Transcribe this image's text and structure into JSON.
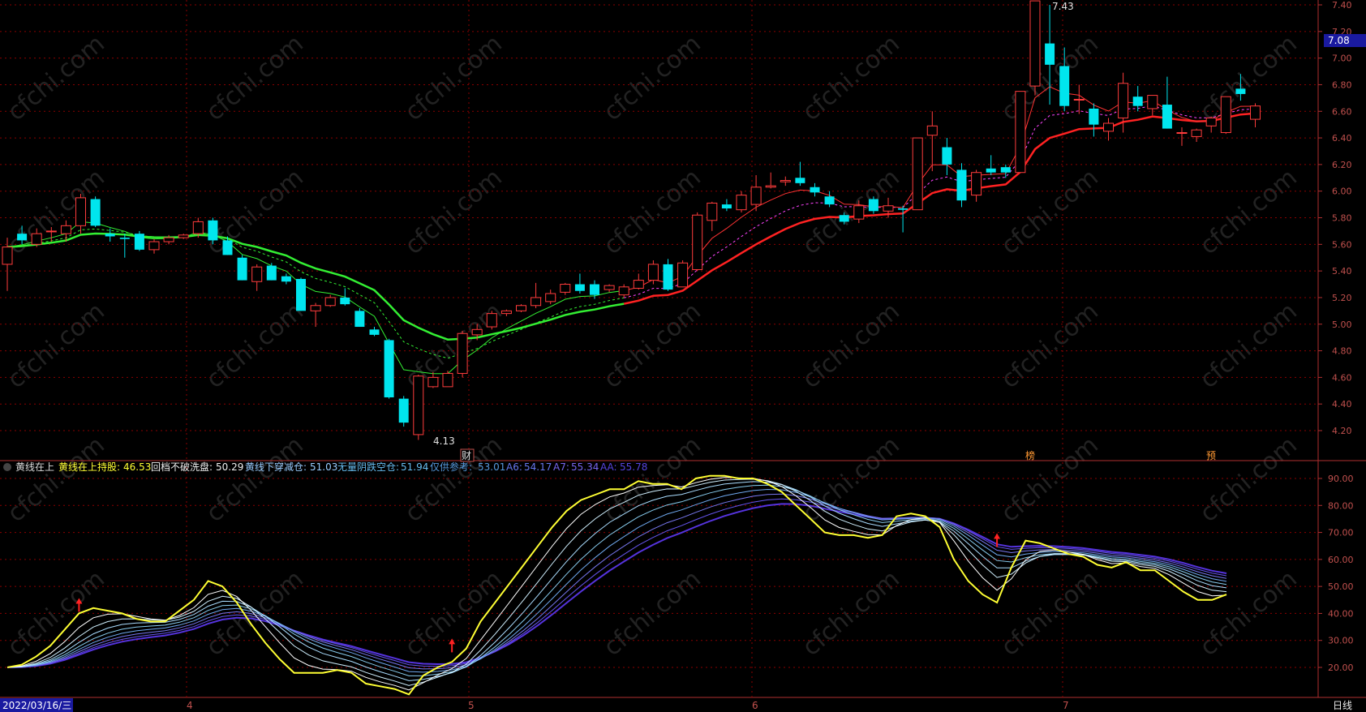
{
  "colors": {
    "background": "#000000",
    "grid": "#8b0000",
    "up": "#ff3c3c",
    "down": "#00e5ee",
    "axis_text": "#c0504d",
    "yellow": "#ffff33",
    "green": "#33ee33",
    "purple": "#9966ff",
    "magenta": "#ff44ff",
    "price_tag_bg": "#1a1aa0"
  },
  "main_panel": {
    "y_ticks": [
      "7.40",
      "7.20",
      "7.00",
      "6.80",
      "6.60",
      "6.40",
      "6.20",
      "6.00",
      "5.80",
      "5.60",
      "5.40",
      "5.20",
      "5.00",
      "4.80",
      "4.60",
      "4.40",
      "4.20"
    ],
    "current_price": "7.08",
    "high_label": "7.43",
    "low_label": "4.13",
    "markers": [
      "财",
      "榜",
      "预"
    ]
  },
  "indicator_panel": {
    "legend": [
      {
        "label": "黄线在上",
        "value": ""
      },
      {
        "label": "黄线在上持股:",
        "value": "46.53"
      },
      {
        "label": "回档不破洗盘:",
        "value": "50.29"
      },
      {
        "label": "黄线下穿减仓:",
        "value": "51.03"
      },
      {
        "label": "无量阴跌空仓:",
        "value": "51.94"
      },
      {
        "label": "仅供参考:",
        "value": "53.01"
      },
      {
        "label": "A6:",
        "value": "54.17"
      },
      {
        "label": "A7:",
        "value": "55.34"
      },
      {
        "label": "AA:",
        "value": "55.78"
      }
    ],
    "y_ticks": [
      "90.00",
      "80.00",
      "70.00",
      "60.00",
      "50.00",
      "40.00",
      "30.00",
      "20.00"
    ]
  },
  "x_axis": {
    "date_label": "2022/03/16/三",
    "month_labels": [
      "4",
      "5",
      "6",
      "7"
    ],
    "period_label": "日线"
  },
  "watermark": "cfchi.com",
  "chart_data": [
    {
      "type": "candlestick",
      "title": "",
      "ylim": [
        4.1,
        7.45
      ],
      "candles": [
        {
          "o": 5.45,
          "h": 5.65,
          "l": 5.25,
          "c": 5.58
        },
        {
          "o": 5.68,
          "h": 5.74,
          "l": 5.6,
          "c": 5.63
        },
        {
          "o": 5.6,
          "h": 5.72,
          "l": 5.58,
          "c": 5.68
        },
        {
          "o": 5.7,
          "h": 5.73,
          "l": 5.62,
          "c": 5.7
        },
        {
          "o": 5.68,
          "h": 5.78,
          "l": 5.62,
          "c": 5.74
        },
        {
          "o": 5.74,
          "h": 5.98,
          "l": 5.68,
          "c": 5.95
        },
        {
          "o": 5.94,
          "h": 5.96,
          "l": 5.73,
          "c": 5.74
        },
        {
          "o": 5.68,
          "h": 5.72,
          "l": 5.62,
          "c": 5.66
        },
        {
          "o": 5.65,
          "h": 5.68,
          "l": 5.5,
          "c": 5.64
        },
        {
          "o": 5.68,
          "h": 5.7,
          "l": 5.55,
          "c": 5.56
        },
        {
          "o": 5.56,
          "h": 5.64,
          "l": 5.53,
          "c": 5.62
        },
        {
          "o": 5.62,
          "h": 5.67,
          "l": 5.6,
          "c": 5.65
        },
        {
          "o": 5.65,
          "h": 5.68,
          "l": 5.64,
          "c": 5.67
        },
        {
          "o": 5.68,
          "h": 5.8,
          "l": 5.65,
          "c": 5.77
        },
        {
          "o": 5.78,
          "h": 5.8,
          "l": 5.6,
          "c": 5.63
        },
        {
          "o": 5.63,
          "h": 5.66,
          "l": 5.52,
          "c": 5.52
        },
        {
          "o": 5.5,
          "h": 5.52,
          "l": 5.33,
          "c": 5.33
        },
        {
          "o": 5.32,
          "h": 5.45,
          "l": 5.25,
          "c": 5.43
        },
        {
          "o": 5.44,
          "h": 5.46,
          "l": 5.33,
          "c": 5.33
        },
        {
          "o": 5.36,
          "h": 5.38,
          "l": 5.3,
          "c": 5.32
        },
        {
          "o": 5.34,
          "h": 5.35,
          "l": 5.1,
          "c": 5.1
        },
        {
          "o": 5.1,
          "h": 5.16,
          "l": 4.98,
          "c": 5.14
        },
        {
          "o": 5.14,
          "h": 5.22,
          "l": 5.13,
          "c": 5.2
        },
        {
          "o": 5.2,
          "h": 5.27,
          "l": 5.14,
          "c": 5.15
        },
        {
          "o": 5.1,
          "h": 5.12,
          "l": 4.98,
          "c": 4.98
        },
        {
          "o": 4.96,
          "h": 4.98,
          "l": 4.91,
          "c": 4.92
        },
        {
          "o": 4.88,
          "h": 4.89,
          "l": 4.44,
          "c": 4.45
        },
        {
          "o": 4.44,
          "h": 4.46,
          "l": 4.23,
          "c": 4.26
        },
        {
          "o": 4.17,
          "h": 4.62,
          "l": 4.13,
          "c": 4.61
        },
        {
          "o": 4.53,
          "h": 4.64,
          "l": 4.52,
          "c": 4.6
        },
        {
          "o": 4.53,
          "h": 4.65,
          "l": 4.53,
          "c": 4.63
        },
        {
          "o": 4.63,
          "h": 4.95,
          "l": 4.6,
          "c": 4.93
        },
        {
          "o": 4.92,
          "h": 5.0,
          "l": 4.88,
          "c": 4.96
        },
        {
          "o": 4.98,
          "h": 5.1,
          "l": 4.96,
          "c": 5.08
        },
        {
          "o": 5.08,
          "h": 5.11,
          "l": 5.06,
          "c": 5.1
        },
        {
          "o": 5.1,
          "h": 5.15,
          "l": 5.09,
          "c": 5.14
        },
        {
          "o": 5.14,
          "h": 5.31,
          "l": 5.12,
          "c": 5.2
        },
        {
          "o": 5.17,
          "h": 5.26,
          "l": 5.15,
          "c": 5.23
        },
        {
          "o": 5.24,
          "h": 5.31,
          "l": 5.22,
          "c": 5.3
        },
        {
          "o": 5.3,
          "h": 5.38,
          "l": 5.23,
          "c": 5.25
        },
        {
          "o": 5.3,
          "h": 5.33,
          "l": 5.19,
          "c": 5.22
        },
        {
          "o": 5.26,
          "h": 5.3,
          "l": 5.24,
          "c": 5.29
        },
        {
          "o": 5.22,
          "h": 5.3,
          "l": 5.2,
          "c": 5.28
        },
        {
          "o": 5.27,
          "h": 5.38,
          "l": 5.26,
          "c": 5.33
        },
        {
          "o": 5.33,
          "h": 5.48,
          "l": 5.3,
          "c": 5.45
        },
        {
          "o": 5.45,
          "h": 5.49,
          "l": 5.25,
          "c": 5.26
        },
        {
          "o": 5.28,
          "h": 5.48,
          "l": 5.28,
          "c": 5.46
        },
        {
          "o": 5.41,
          "h": 5.84,
          "l": 5.4,
          "c": 5.82
        },
        {
          "o": 5.78,
          "h": 5.92,
          "l": 5.7,
          "c": 5.91
        },
        {
          "o": 5.9,
          "h": 5.94,
          "l": 5.85,
          "c": 5.87
        },
        {
          "o": 5.86,
          "h": 6.0,
          "l": 5.84,
          "c": 5.97
        },
        {
          "o": 5.9,
          "h": 6.12,
          "l": 5.85,
          "c": 6.03
        },
        {
          "o": 6.03,
          "h": 6.14,
          "l": 6.02,
          "c": 6.04
        },
        {
          "o": 6.07,
          "h": 6.11,
          "l": 6.04,
          "c": 6.08
        },
        {
          "o": 6.1,
          "h": 6.22,
          "l": 6.04,
          "c": 6.06
        },
        {
          "o": 6.03,
          "h": 6.06,
          "l": 5.96,
          "c": 5.99
        },
        {
          "o": 5.96,
          "h": 6.0,
          "l": 5.88,
          "c": 5.9
        },
        {
          "o": 5.82,
          "h": 5.84,
          "l": 5.75,
          "c": 5.77
        },
        {
          "o": 5.79,
          "h": 5.93,
          "l": 5.76,
          "c": 5.89
        },
        {
          "o": 5.94,
          "h": 5.96,
          "l": 5.83,
          "c": 5.85
        },
        {
          "o": 5.85,
          "h": 5.95,
          "l": 5.8,
          "c": 5.89
        },
        {
          "o": 5.87,
          "h": 5.89,
          "l": 5.69,
          "c": 5.86
        },
        {
          "o": 5.86,
          "h": 6.4,
          "l": 5.86,
          "c": 6.4
        },
        {
          "o": 6.42,
          "h": 6.6,
          "l": 6.15,
          "c": 6.49
        },
        {
          "o": 6.33,
          "h": 6.4,
          "l": 6.12,
          "c": 6.2
        },
        {
          "o": 6.16,
          "h": 6.21,
          "l": 5.88,
          "c": 5.93
        },
        {
          "o": 5.97,
          "h": 6.16,
          "l": 5.92,
          "c": 6.14
        },
        {
          "o": 6.17,
          "h": 6.27,
          "l": 6.12,
          "c": 6.14
        },
        {
          "o": 6.18,
          "h": 6.2,
          "l": 6.1,
          "c": 6.14
        },
        {
          "o": 6.14,
          "h": 6.75,
          "l": 6.14,
          "c": 6.75
        },
        {
          "o": 6.79,
          "h": 7.43,
          "l": 6.72,
          "c": 7.43
        },
        {
          "o": 7.11,
          "h": 7.4,
          "l": 6.65,
          "c": 6.95
        },
        {
          "o": 6.94,
          "h": 7.08,
          "l": 6.6,
          "c": 6.64
        },
        {
          "o": 6.69,
          "h": 6.8,
          "l": 6.58,
          "c": 6.69
        },
        {
          "o": 6.62,
          "h": 6.66,
          "l": 6.41,
          "c": 6.5
        },
        {
          "o": 6.45,
          "h": 6.55,
          "l": 6.38,
          "c": 6.51
        },
        {
          "o": 6.55,
          "h": 6.89,
          "l": 6.44,
          "c": 6.81
        },
        {
          "o": 6.71,
          "h": 6.79,
          "l": 6.6,
          "c": 6.64
        },
        {
          "o": 6.62,
          "h": 6.72,
          "l": 6.57,
          "c": 6.72
        },
        {
          "o": 6.65,
          "h": 6.86,
          "l": 6.47,
          "c": 6.47
        },
        {
          "o": 6.44,
          "h": 6.48,
          "l": 6.34,
          "c": 6.44
        },
        {
          "o": 6.41,
          "h": 6.47,
          "l": 6.37,
          "c": 6.46
        },
        {
          "o": 6.49,
          "h": 6.56,
          "l": 6.44,
          "c": 6.55
        },
        {
          "o": 6.44,
          "h": 6.71,
          "l": 6.43,
          "c": 6.71
        },
        {
          "o": 6.77,
          "h": 6.88,
          "l": 6.68,
          "c": 6.73
        },
        {
          "o": 6.54,
          "h": 6.66,
          "l": 6.48,
          "c": 6.64
        }
      ]
    },
    {
      "type": "line",
      "title": "",
      "ylim": [
        15,
        95
      ],
      "series": [
        {
          "name": "黄线在上持股",
          "values": [
            20,
            21,
            24,
            28,
            34,
            40,
            42,
            41,
            40,
            38,
            37,
            37,
            41,
            45,
            52,
            50,
            44,
            36,
            29,
            23,
            18,
            18,
            18,
            19,
            18,
            14,
            13,
            12,
            10,
            17,
            20,
            22,
            27,
            37,
            44,
            51,
            58,
            65,
            72,
            78,
            82,
            84,
            86,
            86,
            89,
            88,
            88,
            86,
            90,
            91,
            91,
            90,
            90,
            88,
            85,
            80,
            75,
            70,
            69,
            69,
            68,
            69,
            76,
            77,
            76,
            72,
            60,
            52,
            47,
            44,
            57,
            67,
            66,
            64,
            62,
            61,
            58,
            57,
            59,
            56,
            56,
            52,
            48,
            45,
            45,
            47
          ]
        }
      ]
    }
  ]
}
